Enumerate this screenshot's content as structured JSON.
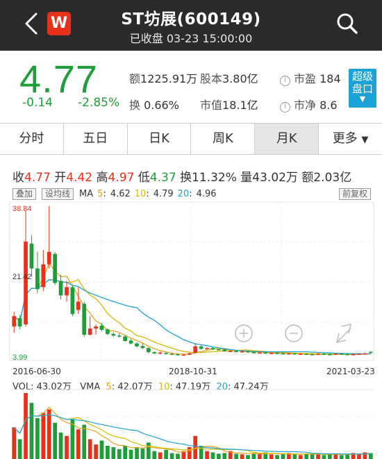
{
  "header": {
    "title": "ST坊展(600149)",
    "subtitle": "已收盘 03-23 15:00:00",
    "logo_text": "W"
  },
  "quote": {
    "price": "4.77",
    "change": "-0.14",
    "change_pct": "-2.85%",
    "amount_label": "额",
    "amount": "1225.91万",
    "share_capital_label": "股本",
    "share_capital": "3.80亿",
    "pe_label": "市盈",
    "pe": "184",
    "turnover_label": "换",
    "turnover": "0.66%",
    "market_cap_label": "市值",
    "market_cap": "18.1亿",
    "pb_label": "市净",
    "pb": "8.6",
    "super_line1": "超级",
    "super_line2": "盘口"
  },
  "tabs": [
    {
      "label": "分时"
    },
    {
      "label": "五日"
    },
    {
      "label": "日K"
    },
    {
      "label": "周K"
    },
    {
      "label": "月K"
    },
    {
      "label": "更多"
    }
  ],
  "ohlc": {
    "close_label": "收",
    "close": "4.77",
    "open_label": "开",
    "open": "4.42",
    "high_label": "高",
    "high": "4.97",
    "low_label": "低",
    "low": "4.37",
    "turnover_label": "换",
    "turnover": "11.32%",
    "volume_label": "量",
    "volume": "43.02万",
    "amount_label": "额",
    "amount": "2.03亿"
  },
  "ma": {
    "overlay_chip": "叠加",
    "ma_chip": "设均线",
    "ma_label": "MA",
    "ma5_label": "5",
    "ma5": "4.62",
    "ma10_label": "10",
    "ma10": "4.79",
    "ma20_label": "20",
    "ma20": "4.96",
    "adjust_chip": "前复权"
  },
  "volume": {
    "label": "VOL",
    "value": "43.02万",
    "vma_label": "VMA",
    "vma5_label": "5",
    "vma5": "42.07万",
    "vma10_label": "10",
    "vma10": "47.19万",
    "vma20_label": "20",
    "vma20": "47.24万"
  },
  "colors": {
    "up": "#e8311a",
    "down": "#1e9e39",
    "ma5": "#e8a21a",
    "ma10": "#d6b800",
    "ma20": "#1ba3d7",
    "accent": "#1ba3d7"
  },
  "icons": {
    "back": "chevron-left-icon",
    "search": "search-icon",
    "zoom_in": "zoom-in-icon",
    "zoom_out": "zoom-out-icon",
    "fullscreen": "expand-icon",
    "info": "info-icon"
  },
  "chart_data": {
    "type": "candlestick",
    "y_max_label": "38.84",
    "y_mid_label": "21.42",
    "y_min_label": "3.99",
    "ylim": [
      3.99,
      38.84
    ],
    "x_labels": [
      "2016-06-30",
      "2018-10-31",
      "2021-03-23"
    ],
    "candles": [
      {
        "o": 11.0,
        "c": 13.5,
        "h": 14.5,
        "l": 9.5
      },
      {
        "o": 13.0,
        "c": 11.0,
        "h": 13.8,
        "l": 10.3
      },
      {
        "o": 11.5,
        "c": 31.5,
        "h": 38.84,
        "l": 11.0
      },
      {
        "o": 31.0,
        "c": 25.0,
        "h": 33.0,
        "l": 23.0
      },
      {
        "o": 25.0,
        "c": 20.0,
        "h": 29.0,
        "l": 19.0
      },
      {
        "o": 20.5,
        "c": 26.0,
        "h": 29.5,
        "l": 19.5
      },
      {
        "o": 26.0,
        "c": 29.0,
        "h": 40.0,
        "l": 25.0
      },
      {
        "o": 28.5,
        "c": 21.5,
        "h": 29.0,
        "l": 21.0
      },
      {
        "o": 22.0,
        "c": 18.5,
        "h": 23.5,
        "l": 17.5
      },
      {
        "o": 18.5,
        "c": 20.5,
        "h": 22.0,
        "l": 17.0
      },
      {
        "o": 20.5,
        "c": 14.0,
        "h": 21.0,
        "l": 13.5
      },
      {
        "o": 15.0,
        "c": 17.0,
        "h": 20.5,
        "l": 14.0
      },
      {
        "o": 16.5,
        "c": 9.0,
        "h": 17.0,
        "l": 8.5
      },
      {
        "o": 9.0,
        "c": 10.5,
        "h": 13.5,
        "l": 8.8
      },
      {
        "o": 10.5,
        "c": 11.0,
        "h": 11.5,
        "l": 9.0
      },
      {
        "o": 11.2,
        "c": 10.2,
        "h": 11.8,
        "l": 9.9
      },
      {
        "o": 10.3,
        "c": 9.2,
        "h": 10.6,
        "l": 8.9
      },
      {
        "o": 9.2,
        "c": 8.8,
        "h": 9.6,
        "l": 8.5
      },
      {
        "o": 8.8,
        "c": 8.6,
        "h": 9.4,
        "l": 8.3
      },
      {
        "o": 8.6,
        "c": 7.5,
        "h": 8.9,
        "l": 7.3
      },
      {
        "o": 7.6,
        "c": 6.9,
        "h": 8.0,
        "l": 6.7
      },
      {
        "o": 6.9,
        "c": 6.2,
        "h": 7.2,
        "l": 6.0
      },
      {
        "o": 6.3,
        "c": 5.8,
        "h": 7.0,
        "l": 5.6
      },
      {
        "o": 5.8,
        "c": 4.8,
        "h": 6.0,
        "l": 4.5
      },
      {
        "o": 4.8,
        "c": 4.5,
        "h": 5.0,
        "l": 4.3
      },
      {
        "o": 4.5,
        "c": 4.7,
        "h": 5.0,
        "l": 4.3
      },
      {
        "o": 4.6,
        "c": 4.4,
        "h": 4.9,
        "l": 4.2
      },
      {
        "o": 4.4,
        "c": 4.3,
        "h": 4.7,
        "l": 4.1
      },
      {
        "o": 4.3,
        "c": 4.1,
        "h": 4.5,
        "l": 4.0
      },
      {
        "o": 4.1,
        "c": 4.2,
        "h": 4.4,
        "l": 3.99
      },
      {
        "o": 4.2,
        "c": 4.5,
        "h": 4.7,
        "l": 4.1
      },
      {
        "o": 4.6,
        "c": 6.2,
        "h": 7.0,
        "l": 4.5
      },
      {
        "o": 6.2,
        "c": 5.6,
        "h": 6.5,
        "l": 5.4
      },
      {
        "o": 5.6,
        "c": 5.8,
        "h": 6.0,
        "l": 5.4
      },
      {
        "o": 5.8,
        "c": 5.5,
        "h": 6.0,
        "l": 5.3
      },
      {
        "o": 5.5,
        "c": 5.4,
        "h": 5.7,
        "l": 5.2
      },
      {
        "o": 5.4,
        "c": 5.0,
        "h": 5.6,
        "l": 4.9
      },
      {
        "o": 5.0,
        "c": 5.1,
        "h": 5.3,
        "l": 4.8
      },
      {
        "o": 5.1,
        "c": 4.9,
        "h": 5.3,
        "l": 4.7
      },
      {
        "o": 4.9,
        "c": 5.0,
        "h": 5.2,
        "l": 4.7
      },
      {
        "o": 5.0,
        "c": 4.8,
        "h": 5.2,
        "l": 4.6
      },
      {
        "o": 4.8,
        "c": 4.6,
        "h": 5.0,
        "l": 4.5
      },
      {
        "o": 4.6,
        "c": 4.7,
        "h": 4.9,
        "l": 4.5
      },
      {
        "o": 4.7,
        "c": 4.5,
        "h": 4.9,
        "l": 4.4
      },
      {
        "o": 4.5,
        "c": 4.6,
        "h": 4.8,
        "l": 4.4
      },
      {
        "o": 4.6,
        "c": 4.5,
        "h": 4.8,
        "l": 4.4
      },
      {
        "o": 4.5,
        "c": 4.4,
        "h": 4.7,
        "l": 4.3
      },
      {
        "o": 4.4,
        "c": 4.5,
        "h": 4.7,
        "l": 4.3
      },
      {
        "o": 4.5,
        "c": 4.3,
        "h": 4.6,
        "l": 4.2
      },
      {
        "o": 4.3,
        "c": 4.4,
        "h": 4.6,
        "l": 4.2
      },
      {
        "o": 4.4,
        "c": 4.3,
        "h": 4.6,
        "l": 4.2
      },
      {
        "o": 4.3,
        "c": 4.2,
        "h": 4.5,
        "l": 4.1
      },
      {
        "o": 4.2,
        "c": 4.4,
        "h": 4.6,
        "l": 4.1
      },
      {
        "o": 4.4,
        "c": 4.3,
        "h": 4.6,
        "l": 4.2
      },
      {
        "o": 4.3,
        "c": 4.2,
        "h": 4.5,
        "l": 4.1
      },
      {
        "o": 4.2,
        "c": 4.4,
        "h": 4.6,
        "l": 4.1
      },
      {
        "o": 4.4,
        "c": 4.3,
        "h": 4.5,
        "l": 4.2
      },
      {
        "o": 4.3,
        "c": 4.2,
        "h": 4.5,
        "l": 4.1
      },
      {
        "o": 4.2,
        "c": 4.3,
        "h": 4.5,
        "l": 4.1
      },
      {
        "o": 4.3,
        "c": 4.4,
        "h": 4.6,
        "l": 4.2
      },
      {
        "o": 4.4,
        "c": 4.5,
        "h": 4.7,
        "l": 4.3
      },
      {
        "o": 4.9,
        "c": 4.77,
        "h": 4.97,
        "l": 4.37
      }
    ],
    "volumes": [
      48,
      30,
      100,
      85,
      62,
      70,
      75,
      55,
      40,
      35,
      60,
      45,
      52,
      30,
      22,
      28,
      20,
      18,
      15,
      20,
      14,
      18,
      16,
      25,
      12,
      10,
      14,
      9,
      8,
      12,
      18,
      35,
      20,
      12,
      10,
      8,
      9,
      12,
      8,
      7,
      6,
      9,
      8,
      10,
      7,
      6,
      8,
      9,
      7,
      6,
      8,
      7,
      9,
      6,
      7,
      8,
      6,
      7,
      9,
      8,
      10,
      9
    ]
  }
}
